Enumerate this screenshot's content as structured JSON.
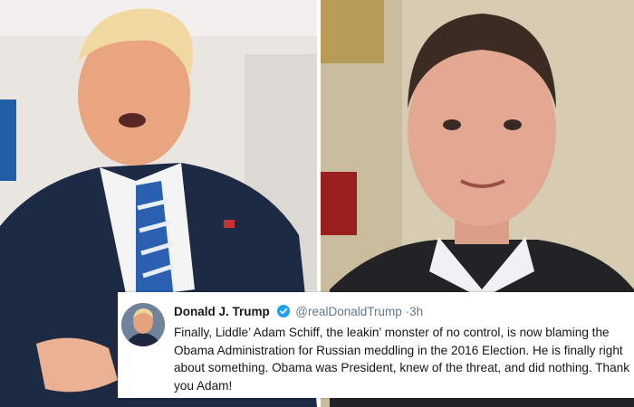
{
  "images": {
    "left_photo": "photo-man-speaking",
    "right_photo": "photo-man-interview"
  },
  "tweet": {
    "author_name": "Donald J. Trump",
    "verified_icon": "verified-badge-icon",
    "handle": "@realDonaldTrump",
    "separator": "·",
    "time": "3h",
    "text": "Finally, Liddle’ Adam Schiff, the leakin’ monster of no control, is now blaming the Obama Administration for Russian meddling in the 2016 Election. He is finally right about something. Obama was President, knew of the threat, and did nothing. Thank you Adam!"
  },
  "colors": {
    "verified": "#1da1f2",
    "text": "#14171a",
    "muted": "#657786"
  }
}
